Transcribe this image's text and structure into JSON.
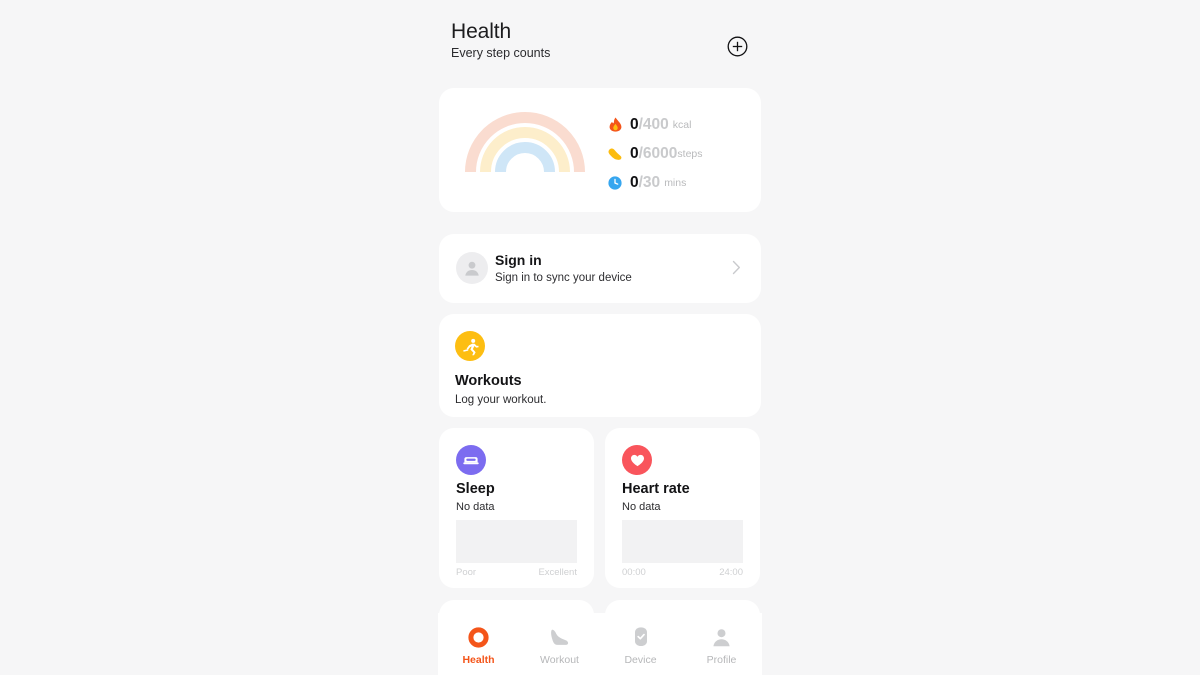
{
  "header": {
    "title": "Health",
    "subtitle": "Every step counts",
    "add_icon": "plus-circle-icon"
  },
  "colors": {
    "background": "#f6f6f7",
    "card": "#ffffff",
    "accent": "#f4551a",
    "calorie": "#f4551a",
    "steps": "#fcbc10",
    "time": "#36a6ef",
    "sleep": "#7c6cf0",
    "heart": "#f9555c",
    "workout": "#fdbe12",
    "ring_calorie": "#fadcd0",
    "ring_steps": "#fdeecb",
    "ring_time": "#cfe6f7",
    "muted": "#b9babc",
    "placeholder": "#f2f2f3"
  },
  "rings_card": {
    "rings": [
      {
        "name": "calories-ring",
        "color": "#fadcd0"
      },
      {
        "name": "steps-ring",
        "color": "#fdeecb"
      },
      {
        "name": "active-time-ring",
        "color": "#cfe6f7"
      }
    ],
    "stats": [
      {
        "icon": "flame-icon",
        "current": "0",
        "goal": "/400",
        "unit": "kcal",
        "tight": false
      },
      {
        "icon": "footprint-icon",
        "current": "0",
        "goal": "/6000",
        "unit": "steps",
        "tight": true
      },
      {
        "icon": "clock-icon",
        "current": "0",
        "goal": "/30",
        "unit": "mins",
        "tight": false
      }
    ]
  },
  "signin_card": {
    "icon": "person-avatar-icon",
    "title": "Sign in",
    "subtitle": "Sign in to sync your device",
    "chevron": "chevron-right-icon"
  },
  "workouts_card": {
    "icon": "running-person-icon",
    "title": "Workouts",
    "subtitle": "Log your workout."
  },
  "sleep_card": {
    "icon": "bed-icon",
    "title": "Sleep",
    "status": "No data",
    "axis_left": "Poor",
    "axis_right": "Excellent"
  },
  "heart_card": {
    "icon": "heart-icon",
    "title": "Heart rate",
    "status": "No data",
    "axis_left": "00:00",
    "axis_right": "24:00"
  },
  "peek_cards": [
    {
      "name": "peek-card-left",
      "badge_color": "#fcbc10"
    },
    {
      "name": "peek-card-right",
      "badge_color": "#f4551a"
    }
  ],
  "bottom_nav": {
    "items": [
      {
        "label": "Health",
        "icon": "health-ring-icon",
        "active": true
      },
      {
        "label": "Workout",
        "icon": "shoe-icon",
        "active": false
      },
      {
        "label": "Device",
        "icon": "watch-check-icon",
        "active": false
      },
      {
        "label": "Profile",
        "icon": "person-icon",
        "active": false
      }
    ]
  }
}
